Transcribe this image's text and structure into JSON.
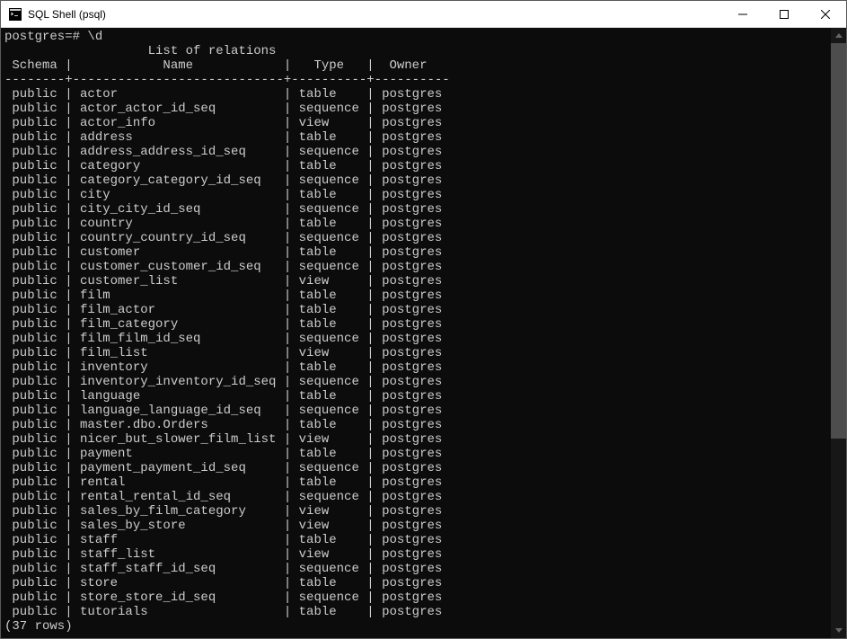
{
  "window": {
    "title": "SQL Shell (psql)"
  },
  "terminal": {
    "prompt": "postgres=# \\d",
    "header_title": "                   List of relations",
    "columns": {
      "schema": "Schema",
      "name": "Name",
      "type": "Type",
      "owner": "Owner"
    },
    "rows": [
      {
        "schema": "public",
        "name": "actor",
        "type": "table",
        "owner": "postgres"
      },
      {
        "schema": "public",
        "name": "actor_actor_id_seq",
        "type": "sequence",
        "owner": "postgres"
      },
      {
        "schema": "public",
        "name": "actor_info",
        "type": "view",
        "owner": "postgres"
      },
      {
        "schema": "public",
        "name": "address",
        "type": "table",
        "owner": "postgres"
      },
      {
        "schema": "public",
        "name": "address_address_id_seq",
        "type": "sequence",
        "owner": "postgres"
      },
      {
        "schema": "public",
        "name": "category",
        "type": "table",
        "owner": "postgres"
      },
      {
        "schema": "public",
        "name": "category_category_id_seq",
        "type": "sequence",
        "owner": "postgres"
      },
      {
        "schema": "public",
        "name": "city",
        "type": "table",
        "owner": "postgres"
      },
      {
        "schema": "public",
        "name": "city_city_id_seq",
        "type": "sequence",
        "owner": "postgres"
      },
      {
        "schema": "public",
        "name": "country",
        "type": "table",
        "owner": "postgres"
      },
      {
        "schema": "public",
        "name": "country_country_id_seq",
        "type": "sequence",
        "owner": "postgres"
      },
      {
        "schema": "public",
        "name": "customer",
        "type": "table",
        "owner": "postgres"
      },
      {
        "schema": "public",
        "name": "customer_customer_id_seq",
        "type": "sequence",
        "owner": "postgres"
      },
      {
        "schema": "public",
        "name": "customer_list",
        "type": "view",
        "owner": "postgres"
      },
      {
        "schema": "public",
        "name": "film",
        "type": "table",
        "owner": "postgres"
      },
      {
        "schema": "public",
        "name": "film_actor",
        "type": "table",
        "owner": "postgres"
      },
      {
        "schema": "public",
        "name": "film_category",
        "type": "table",
        "owner": "postgres"
      },
      {
        "schema": "public",
        "name": "film_film_id_seq",
        "type": "sequence",
        "owner": "postgres"
      },
      {
        "schema": "public",
        "name": "film_list",
        "type": "view",
        "owner": "postgres"
      },
      {
        "schema": "public",
        "name": "inventory",
        "type": "table",
        "owner": "postgres"
      },
      {
        "schema": "public",
        "name": "inventory_inventory_id_seq",
        "type": "sequence",
        "owner": "postgres"
      },
      {
        "schema": "public",
        "name": "language",
        "type": "table",
        "owner": "postgres"
      },
      {
        "schema": "public",
        "name": "language_language_id_seq",
        "type": "sequence",
        "owner": "postgres"
      },
      {
        "schema": "public",
        "name": "master.dbo.Orders",
        "type": "table",
        "owner": "postgres"
      },
      {
        "schema": "public",
        "name": "nicer_but_slower_film_list",
        "type": "view",
        "owner": "postgres"
      },
      {
        "schema": "public",
        "name": "payment",
        "type": "table",
        "owner": "postgres"
      },
      {
        "schema": "public",
        "name": "payment_payment_id_seq",
        "type": "sequence",
        "owner": "postgres"
      },
      {
        "schema": "public",
        "name": "rental",
        "type": "table",
        "owner": "postgres"
      },
      {
        "schema": "public",
        "name": "rental_rental_id_seq",
        "type": "sequence",
        "owner": "postgres"
      },
      {
        "schema": "public",
        "name": "sales_by_film_category",
        "type": "view",
        "owner": "postgres"
      },
      {
        "schema": "public",
        "name": "sales_by_store",
        "type": "view",
        "owner": "postgres"
      },
      {
        "schema": "public",
        "name": "staff",
        "type": "table",
        "owner": "postgres"
      },
      {
        "schema": "public",
        "name": "staff_list",
        "type": "view",
        "owner": "postgres"
      },
      {
        "schema": "public",
        "name": "staff_staff_id_seq",
        "type": "sequence",
        "owner": "postgres"
      },
      {
        "schema": "public",
        "name": "store",
        "type": "table",
        "owner": "postgres"
      },
      {
        "schema": "public",
        "name": "store_store_id_seq",
        "type": "sequence",
        "owner": "postgres"
      },
      {
        "schema": "public",
        "name": "tutorials",
        "type": "table",
        "owner": "postgres"
      }
    ],
    "footer": "(37 rows)",
    "col_widths": {
      "schema": 8,
      "name": 28,
      "type": 10,
      "owner": 10
    }
  }
}
